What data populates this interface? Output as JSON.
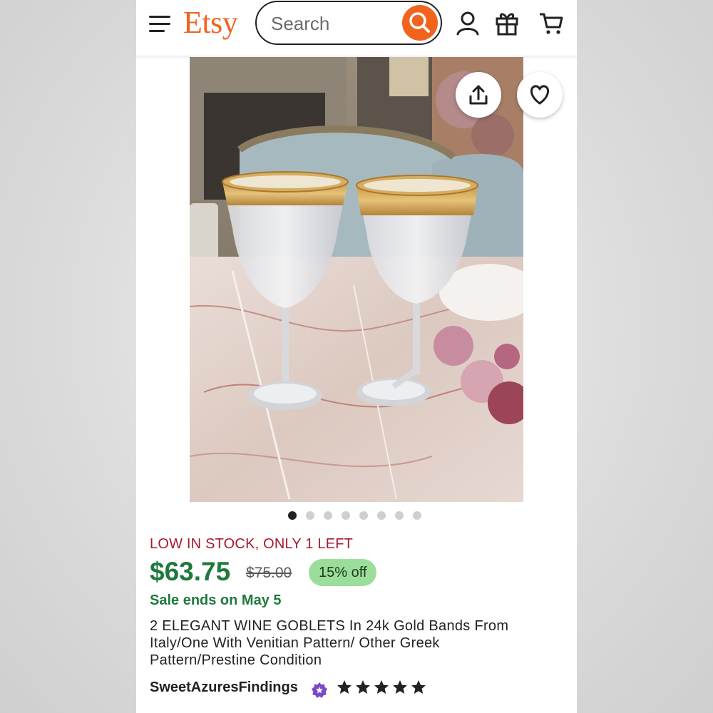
{
  "header": {
    "logo": "Etsy",
    "search_placeholder": "Search",
    "icons": [
      "menu-icon",
      "search-icon",
      "account-icon",
      "gift-icon",
      "cart-icon"
    ]
  },
  "gallery": {
    "image_alt": "Two wine goblets with gold bands on a marble table",
    "actions": [
      "share-icon",
      "heart-icon"
    ],
    "pagination": {
      "total": 8,
      "current": 1
    }
  },
  "listing": {
    "stock_notice": "LOW IN STOCK, ONLY 1 LEFT",
    "price": "$63.75",
    "original_price": "$75.00",
    "discount_badge": "15% off",
    "sale_notice": "Sale ends on May 5",
    "title": "2 ELEGANT WINE GOBLETS In 24k Gold Bands From Italy/One With Venitian Pattern/ Other Greek Pattern/Prestine Condition",
    "shop_name": "SweetAzuresFindings",
    "rating": 5,
    "rating_max": 5
  },
  "colors": {
    "brand": "#f1641e",
    "price_green": "#1e7a3c",
    "stock_red": "#a61a2e",
    "badge_green": "#9bde9b",
    "star_seller_purple": "#7b49c6"
  }
}
